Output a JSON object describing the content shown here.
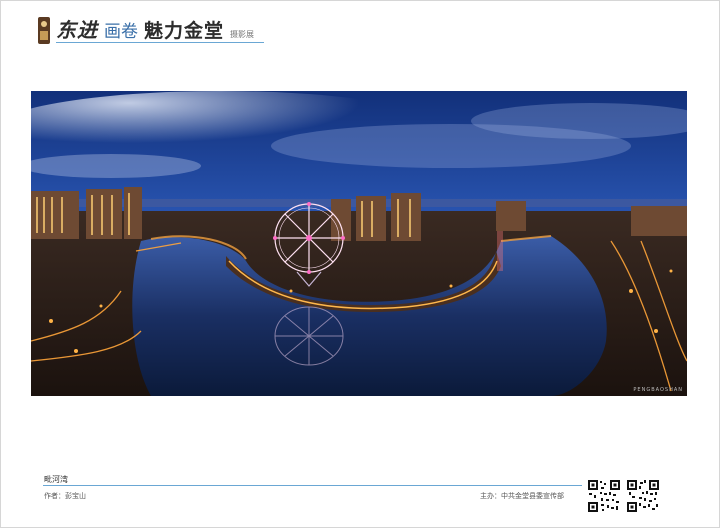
{
  "header": {
    "brush_title": "东进",
    "mid_title": "画卷",
    "cap_title": "魅力金堂",
    "tag": "摄影展"
  },
  "photo": {
    "subject": "city-night-river-ferris-wheel-panorama",
    "credit_mark": "PENGBAOSHAN"
  },
  "caption": {
    "title": "毗河湾",
    "author": "作者：彭宝山",
    "organizer": "主办：中共金堂县委宣传部"
  },
  "colors": {
    "accent_rule": "#6aa7d4",
    "sky_top": "#12307a",
    "river": "#0b1a3a"
  },
  "icons": [
    "qr-code-icon",
    "qr-code-icon"
  ]
}
